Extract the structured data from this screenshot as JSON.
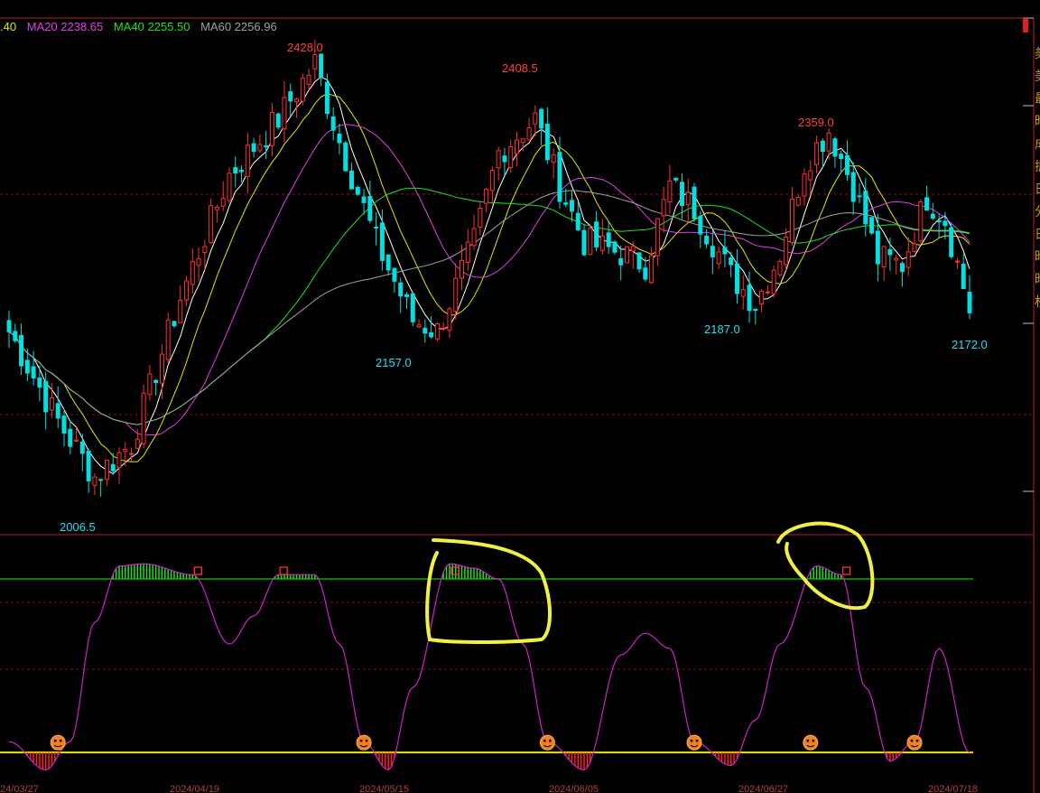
{
  "legend": {
    "ma_first": {
      "label": ".40",
      "color": "#e6e600"
    },
    "ma20": {
      "label": "MA20 2238.65",
      "color": "#e040e0"
    },
    "ma40": {
      "label": "MA40 2255.50",
      "color": "#20e020"
    },
    "ma60": {
      "label": "MA60 2256.96",
      "color": "#a0a0a0"
    }
  },
  "colors": {
    "up": "#ff3030",
    "down": "#00e0e0",
    "grid": "#8a1010",
    "border": "#c02020",
    "osc": "#d020d0",
    "upper_line": "#10a010",
    "zero_line": "#e6e600",
    "annotation": "#f0f040",
    "high_label": "#ff4040",
    "low_label": "#20e0f0"
  },
  "chart_data": [
    {
      "type": "candlestick",
      "price_labels": {
        "highs": [
          "2428.0",
          "2408.5",
          "2359.0"
        ],
        "lows": [
          "2006.5",
          "2157.0",
          "2187.0",
          "2172.0"
        ]
      },
      "ylim": [
        1990,
        2450
      ],
      "anchors": [
        {
          "i": 0,
          "price": 2170
        },
        {
          "i": 8,
          "price": 2090
        },
        {
          "i": 14,
          "price": 2040
        },
        {
          "i": 20,
          "price": 2070
        },
        {
          "i": 28,
          "price": 2200
        },
        {
          "i": 36,
          "price": 2310
        },
        {
          "i": 44,
          "price": 2360
        },
        {
          "i": 50,
          "price": 2410
        },
        {
          "i": 54,
          "price": 2340
        },
        {
          "i": 60,
          "price": 2250
        },
        {
          "i": 66,
          "price": 2180
        },
        {
          "i": 70,
          "price": 2170
        },
        {
          "i": 76,
          "price": 2250
        },
        {
          "i": 80,
          "price": 2330
        },
        {
          "i": 86,
          "price": 2360
        },
        {
          "i": 90,
          "price": 2300
        },
        {
          "i": 94,
          "price": 2250
        },
        {
          "i": 100,
          "price": 2240
        },
        {
          "i": 104,
          "price": 2230
        },
        {
          "i": 108,
          "price": 2300
        },
        {
          "i": 112,
          "price": 2280
        },
        {
          "i": 118,
          "price": 2220
        },
        {
          "i": 122,
          "price": 2195
        },
        {
          "i": 126,
          "price": 2240
        },
        {
          "i": 130,
          "price": 2320
        },
        {
          "i": 134,
          "price": 2350
        },
        {
          "i": 138,
          "price": 2300
        },
        {
          "i": 142,
          "price": 2235
        },
        {
          "i": 146,
          "price": 2230
        },
        {
          "i": 150,
          "price": 2290
        },
        {
          "i": 153,
          "price": 2270
        },
        {
          "i": 157,
          "price": 2190
        }
      ],
      "n_bars": 158
    },
    {
      "type": "line",
      "name": "oscillator",
      "ylim": [
        -12,
        100
      ],
      "upper_threshold": 80,
      "x": [
        0,
        6,
        10,
        14,
        18,
        22,
        30,
        36,
        40,
        44,
        50,
        54,
        58,
        62,
        66,
        72,
        76,
        80,
        84,
        88,
        94,
        100,
        104,
        108,
        112,
        118,
        122,
        126,
        132,
        136,
        140,
        144,
        148,
        152,
        157
      ],
      "y": [
        5,
        -8,
        5,
        60,
        86,
        87,
        82,
        50,
        63,
        82,
        82,
        50,
        5,
        -8,
        30,
        87,
        85,
        80,
        50,
        5,
        -8,
        45,
        55,
        48,
        5,
        -6,
        15,
        50,
        86,
        82,
        30,
        -4,
        5,
        48,
        0
      ]
    }
  ],
  "markers": {
    "faces": [
      "face-icon",
      "face-icon",
      "face-icon",
      "face-icon",
      "face-icon"
    ],
    "squares": [
      "square-marker",
      "square-marker",
      "square-marker",
      "square-marker"
    ]
  },
  "x_axis": {
    "ticks": [
      "24/03/27",
      "2024/04/19",
      "2024/05/15",
      "2024/06/05",
      "2024/06/27",
      "2024/07/18"
    ]
  },
  "right_panel_chars": [
    "美",
    "美",
    "最",
    "昨",
    "成",
    "振",
    "日",
    "分",
    "日",
    "昨",
    "昨",
    "权"
  ]
}
